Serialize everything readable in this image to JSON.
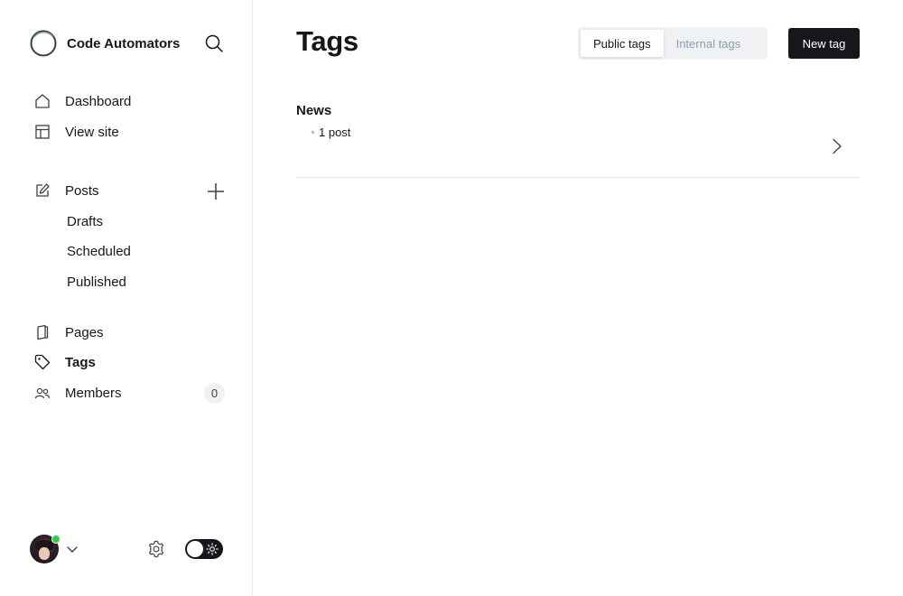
{
  "sidebar": {
    "brand": {
      "name": "Code Automators",
      "logo_icon": "circle-logo-icon"
    },
    "nav": {
      "dashboard": "Dashboard",
      "view_site": "View site",
      "posts": "Posts",
      "drafts": "Drafts",
      "scheduled": "Scheduled",
      "published": "Published",
      "pages": "Pages",
      "tags": "Tags",
      "members": "Members",
      "members_count": "0"
    },
    "footer": {
      "online_status_color": "#30cf43",
      "theme_mode": "dark-toggle"
    }
  },
  "main": {
    "title": "Tags",
    "tabs": [
      {
        "label": "Public tags",
        "active": true
      },
      {
        "label": "Internal tags",
        "active": false
      }
    ],
    "new_button": "New tag",
    "tags": [
      {
        "name": "News",
        "count_label": "1 post"
      }
    ]
  },
  "colors": {
    "text": "#15171a",
    "muted": "#8e9cac",
    "primary_button": "#15171a",
    "border": "#e6e9eb"
  }
}
